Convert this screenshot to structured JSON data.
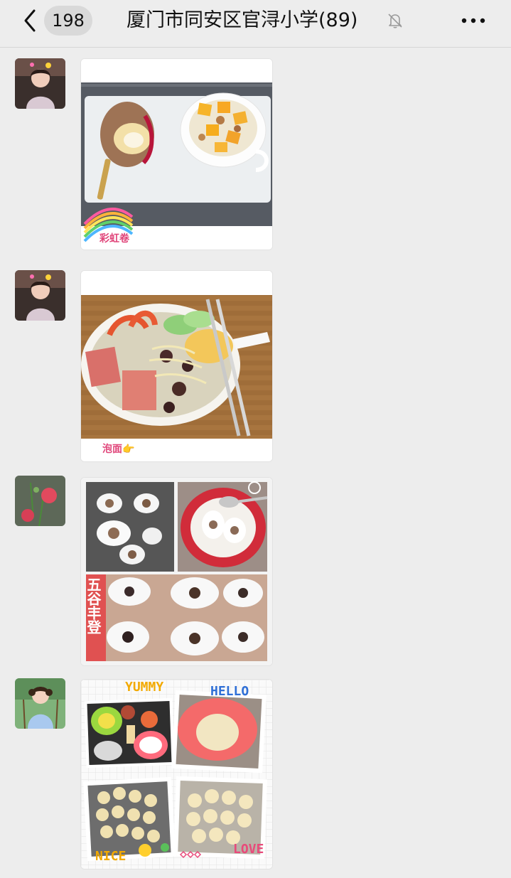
{
  "header": {
    "unread_count": "198",
    "title": "厦门市同安区官浔小学(89)"
  },
  "icons": {
    "back": "chevron-left-icon",
    "mute": "bell-off-icon",
    "more": "more-dots-icon"
  },
  "messages": [
    {
      "caption": "彩虹卷"
    },
    {
      "caption": "泡面👉"
    },
    {
      "caption": "五谷丰登"
    },
    {
      "stickers": [
        "YUMMY",
        "HELLO",
        "NICE",
        "LOVE"
      ]
    }
  ]
}
